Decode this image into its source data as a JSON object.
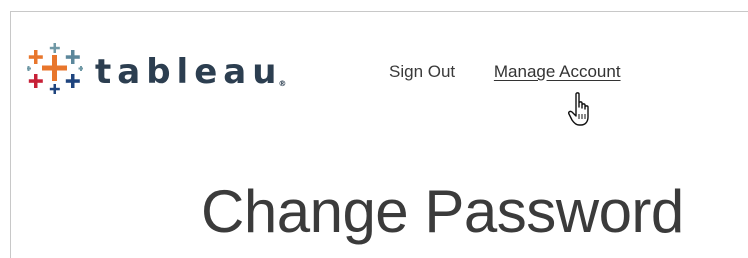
{
  "brand": {
    "name": "tableau",
    "trademark": "®",
    "colors": {
      "orange": "#e8762c",
      "red": "#c72037",
      "blue": "#5b879b",
      "teal": "#1f447e",
      "navy": "#2c3e50"
    }
  },
  "nav": {
    "sign_out_label": "Sign Out",
    "manage_account_label": "Manage Account"
  },
  "cursor": {
    "icon": "hand-pointer-icon"
  },
  "main": {
    "title": "Change Password"
  }
}
